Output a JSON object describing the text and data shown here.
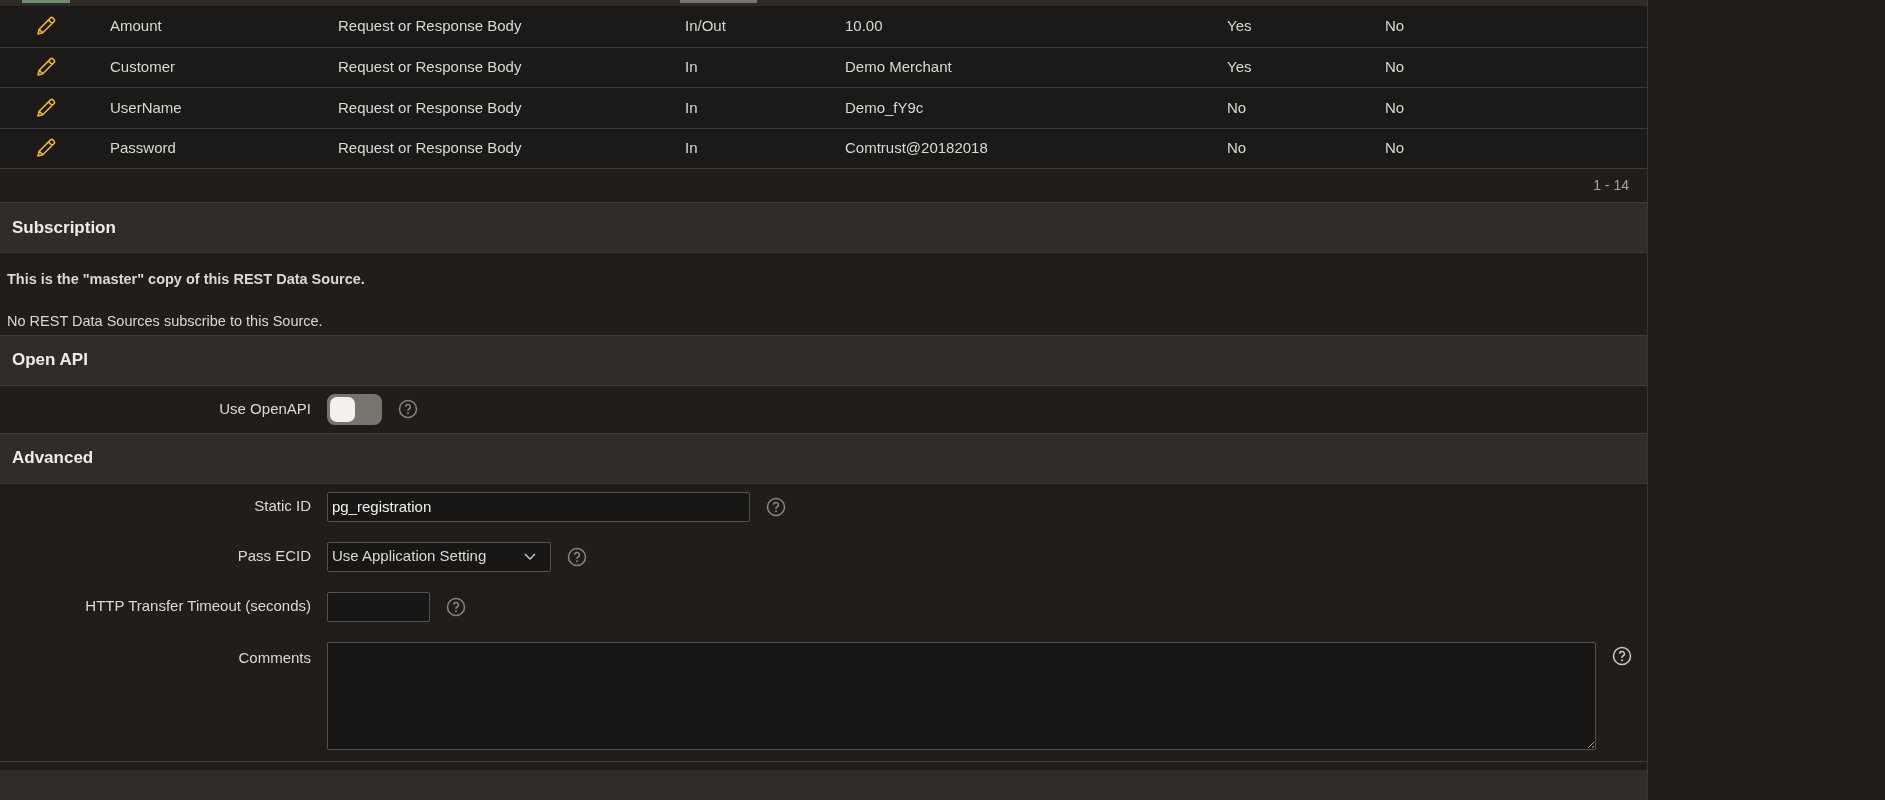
{
  "table": {
    "rows": [
      {
        "column_1": "Amount",
        "column_2": "Request or Response Body",
        "column_3": "In/Out",
        "column_4": "10.00",
        "column_5": "Yes",
        "column_6": "No"
      },
      {
        "column_1": "Customer",
        "column_2": "Request or Response Body",
        "column_3": "In",
        "column_4": "Demo Merchant",
        "column_5": "Yes",
        "column_6": "No"
      },
      {
        "column_1": "UserName",
        "column_2": "Request or Response Body",
        "column_3": "In",
        "column_4": "Demo_fY9c",
        "column_5": "No",
        "column_6": "No"
      },
      {
        "column_1": "Password",
        "column_2": "Request or Response Body",
        "column_3": "In",
        "column_4": "Comtrust@20182018",
        "column_5": "No",
        "column_6": "No"
      }
    ],
    "pagination": "1 - 14"
  },
  "sections": [
    {
      "title": "Subscription",
      "kind": "text",
      "lines": [
        {
          "text": "This is the \"master\" copy of this REST Data Source.",
          "bold": true
        },
        {
          "text": "No REST Data Sources subscribe to this Source.",
          "bold": false
        }
      ]
    },
    {
      "title": "Open API",
      "kind": "form",
      "fields": [
        {
          "kind": "switch",
          "label": "Use OpenAPI",
          "on": false
        }
      ]
    },
    {
      "title": "Advanced",
      "kind": "form",
      "fields": [
        {
          "kind": "text",
          "label": "Static ID",
          "value": "pg_registration"
        },
        {
          "kind": "select",
          "label": "Pass ECID",
          "value": "Use Application Setting"
        },
        {
          "kind": "number",
          "label": "HTTP Transfer Timeout (seconds)"
        },
        {
          "kind": "textarea",
          "label": "Comments"
        }
      ]
    }
  ]
}
